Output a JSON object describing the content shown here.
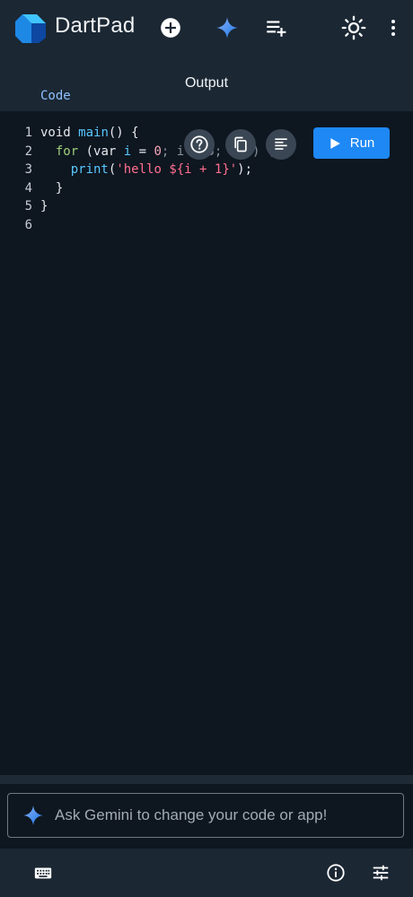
{
  "header": {
    "title": "DartPad",
    "icons": [
      "dart-logo",
      "add-circle-icon",
      "gemini-sparkle-icon",
      "playlist-add-icon",
      "brightness-icon",
      "more-vertical-icon"
    ]
  },
  "tabs": [
    {
      "label": "Code",
      "active": true
    },
    {
      "label": "Output",
      "active": false
    }
  ],
  "editor": {
    "line_numbers": [
      "1",
      "2",
      "3",
      "4",
      "5",
      "6"
    ],
    "lines": {
      "l1_kw": "void",
      "l1_fn": "main",
      "l1_rest": "() {",
      "l2_indent": "  ",
      "l2_for": "for",
      "l2_paren": " (var ",
      "l2_i": "i",
      "l2_eq": " = ",
      "l2_zero": "0",
      "l2_tail": "; i < 5; i++) {",
      "l3_indent": "    ",
      "l3_print": "print",
      "l3_paren": "(",
      "l3_str": "'hello ${i + 1}'",
      "l3_end": ");",
      "l4": "  }",
      "l5": "}"
    },
    "run_label": "Run",
    "tool_icons": [
      "help-icon",
      "copy-icon",
      "format-icon"
    ]
  },
  "gemini": {
    "placeholder": "Ask Gemini to change your code or app!"
  },
  "bottom_bar": {
    "icons": [
      "keyboard-icon",
      "info-icon",
      "tune-icon"
    ]
  },
  "colors": {
    "background": "#0e1620",
    "header": "#1b2733",
    "accent": "#8fc3ff",
    "run_button": "#1e88f5"
  }
}
